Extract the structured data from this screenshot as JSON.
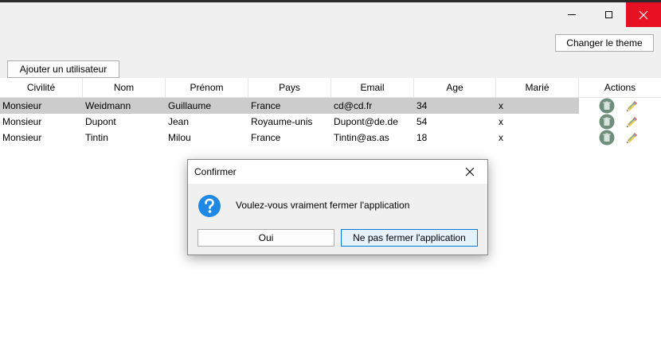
{
  "window": {
    "close_color": "#e81123",
    "icons": [
      "minimize-icon",
      "maximize-icon",
      "close-icon"
    ]
  },
  "toolbar": {
    "theme_button": "Changer le theme",
    "add_user_button": "Ajouter un utilisateur"
  },
  "table": {
    "columns": [
      "Civilité",
      "Nom",
      "Prénom",
      "Pays",
      "Email",
      "Age",
      "Marié",
      "Actions"
    ],
    "rows": [
      {
        "civilite": "Monsieur",
        "nom": "Weidmann",
        "prenom": "Guillaume",
        "pays": "France",
        "email": "cd@cd.fr",
        "age": "34",
        "marie": "x",
        "selected": true
      },
      {
        "civilite": "Monsieur",
        "nom": "Dupont",
        "prenom": "Jean",
        "pays": "Royaume-unis",
        "email": "Dupont@de.de",
        "age": "54",
        "marie": "x",
        "selected": false
      },
      {
        "civilite": "Monsieur",
        "nom": "Tintin",
        "prenom": "Milou",
        "pays": "France",
        "email": "Tintin@as.as",
        "age": "18",
        "marie": "x",
        "selected": false
      }
    ],
    "row_action_icons": [
      "trash-icon",
      "pencil-icon"
    ]
  },
  "dialog": {
    "title": "Confirmer",
    "message": "Voulez-vous vraiment fermer l'application",
    "yes_button": "Oui",
    "no_button": "Ne pas fermer l'application",
    "icon": "question-icon",
    "accent_color": "#0078d7"
  }
}
